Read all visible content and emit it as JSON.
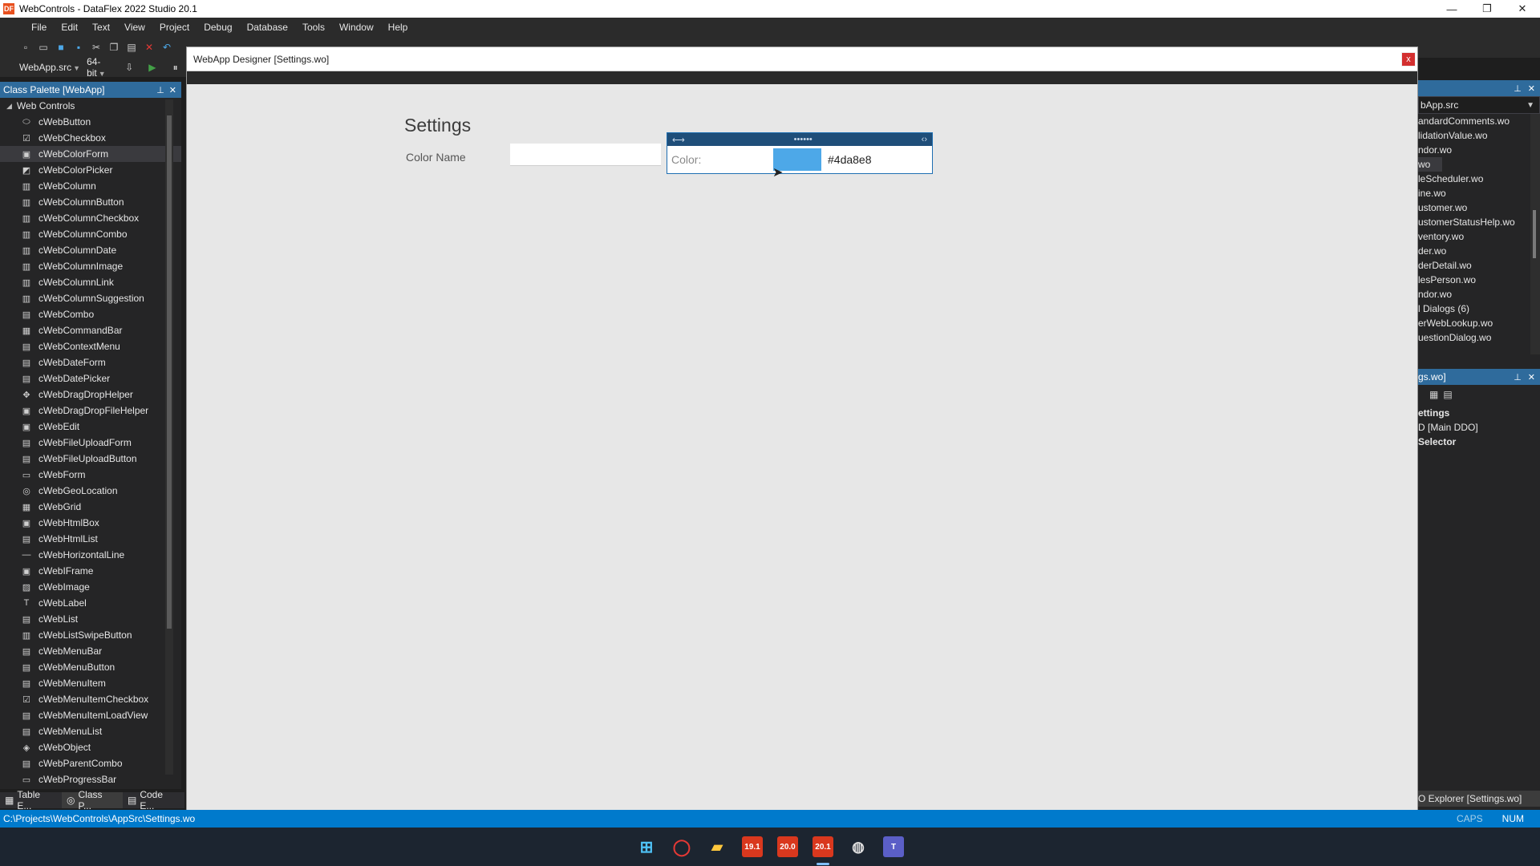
{
  "window": {
    "title": "WebControls - DataFlex 2022 Studio 20.1",
    "app_icon": "DF",
    "minimize": "—",
    "maximize": "❐",
    "close": "✕"
  },
  "menu": [
    "File",
    "Edit",
    "Text",
    "View",
    "Project",
    "Debug",
    "Database",
    "Tools",
    "Window",
    "Help"
  ],
  "toolbar2": {
    "workspace": "WebApp.src",
    "platform": "64-bit"
  },
  "palette": {
    "title": "Class Palette [WebApp]",
    "group": "Web Controls",
    "selected_index": 2,
    "items": [
      "cWebButton",
      "cWebCheckbox",
      "cWebColorForm",
      "cWebColorPicker",
      "cWebColumn",
      "cWebColumnButton",
      "cWebColumnCheckbox",
      "cWebColumnCombo",
      "cWebColumnDate",
      "cWebColumnImage",
      "cWebColumnLink",
      "cWebColumnSuggestion",
      "cWebCombo",
      "cWebCommandBar",
      "cWebContextMenu",
      "cWebDateForm",
      "cWebDatePicker",
      "cWebDragDropHelper",
      "cWebDragDropFileHelper",
      "cWebEdit",
      "cWebFileUploadForm",
      "cWebFileUploadButton",
      "cWebForm",
      "cWebGeoLocation",
      "cWebGrid",
      "cWebHtmlBox",
      "cWebHtmlList",
      "cWebHorizontalLine",
      "cWebIFrame",
      "cWebImage",
      "cWebLabel",
      "cWebList",
      "cWebListSwipeButton",
      "cWebMenuBar",
      "cWebMenuButton",
      "cWebMenuItem",
      "cWebMenuItemCheckbox",
      "cWebMenuItemLoadView",
      "cWebMenuList",
      "cWebObject",
      "cWebParentCombo",
      "cWebProgressBar"
    ]
  },
  "left_tabs": [
    "Table E...",
    "Class P...",
    "Code E..."
  ],
  "status": {
    "path": "C:\\Projects\\WebControls\\AppSrc\\Settings.wo",
    "caps": "CAPS",
    "num": "NUM"
  },
  "designer": {
    "title": "WebApp Designer [Settings.wo]",
    "close": "x",
    "view_title": "Settings",
    "color_name_label": "Color Name",
    "color_name_value": "",
    "picker": {
      "left_handle": "⟷",
      "center_handle": "••••••",
      "right_handle": "‹›",
      "label": "Color:",
      "swatch_color": "#4da8e8",
      "value": "#4da8e8"
    }
  },
  "workspace_panel": {
    "combo": "bApp.src",
    "items": [
      "andardComments.wo",
      "lidationValue.wo",
      "ndor.wo",
      "wo",
      "leScheduler.wo",
      "ine.wo",
      "ustomer.wo",
      "ustomerStatusHelp.wo",
      "ventory.wo",
      "der.wo",
      "derDetail.wo",
      "lesPerson.wo",
      "ndor.wo",
      "l Dialogs (6)",
      "erWebLookup.wo",
      "uestionDialog.wo"
    ],
    "selected_index": 3
  },
  "ddo_panel": {
    "title": "gs.wo]",
    "tree": [
      "ettings",
      "D [Main DDO]",
      "Selector"
    ],
    "bottom_tab": "O Explorer [Settings.wo]"
  },
  "taskbar": [
    "19.1",
    "20.0",
    "20.1"
  ]
}
